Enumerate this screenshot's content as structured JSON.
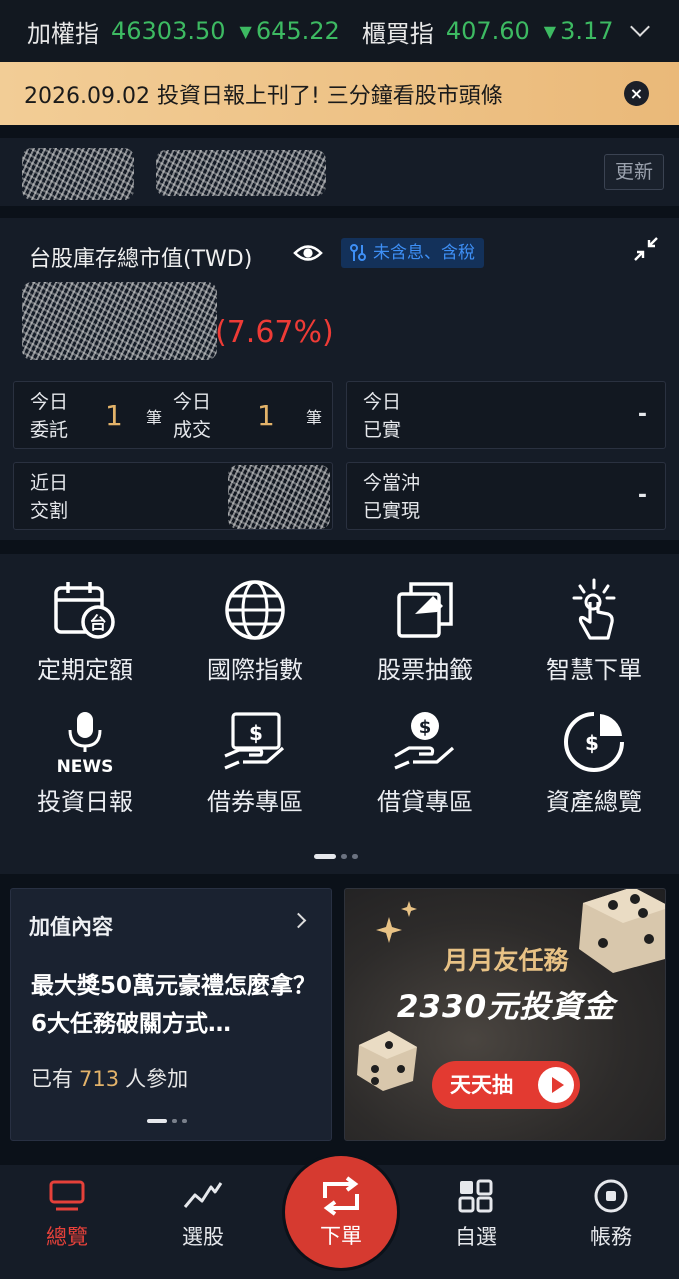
{
  "ticker": {
    "taiex_name": "加權指",
    "taiex_value": "46303.50",
    "taiex_change": "645.22",
    "otc_name": "櫃買指",
    "otc_value": "407.60",
    "otc_change": "3.17",
    "down_color": "#3dba62"
  },
  "notice": {
    "text": "2026.09.02 投資日報上刊了! 三分鐘看股市頭條",
    "close_label": "×"
  },
  "account": {
    "refresh_label": "更新"
  },
  "portfolio": {
    "title": "台股庫存總市值(TWD)",
    "tax_badge": "未含息、含稅",
    "percent": "(7.67%)",
    "boxes": {
      "today_orders": {
        "label1": "今日",
        "label2": "委託",
        "value": "1",
        "unit": "筆"
      },
      "today_fills": {
        "label1": "今日",
        "label2": "成交",
        "value": "1",
        "unit": "筆"
      },
      "today_realized": {
        "label1": "今日",
        "label2": "已實",
        "value": "-"
      },
      "recent_settle": {
        "label1": "近日",
        "label2": "交割"
      },
      "daytrade_realized": {
        "label1": "今當沖",
        "label2": "已實現",
        "value": "-"
      }
    }
  },
  "shortcuts": {
    "items": [
      {
        "label": "定期定額",
        "icon": "calendar-tw-icon"
      },
      {
        "label": "國際指數",
        "icon": "globe-icon"
      },
      {
        "label": "股票抽籤",
        "icon": "lottery-card-icon"
      },
      {
        "label": "智慧下單",
        "icon": "smart-tap-icon"
      },
      {
        "label": "投資日報",
        "icon": "news-mic-icon",
        "icon_text": "NEWS"
      },
      {
        "label": "借券專區",
        "icon": "stock-lending-icon",
        "icon_text": "$"
      },
      {
        "label": "借貸專區",
        "icon": "loan-hand-icon",
        "icon_text": "$"
      },
      {
        "label": "資產總覽",
        "icon": "asset-overview-icon",
        "icon_text": "$"
      }
    ]
  },
  "value_card": {
    "heading": "加值內容",
    "body": "最大獎50萬元豪禮怎麼拿？6大任務破關方式…",
    "join_prefix": "已有",
    "join_count": "713",
    "join_suffix": "人參加"
  },
  "promo_card": {
    "line1": "月月友任務",
    "line2": "2330元投資金",
    "button": "天天抽"
  },
  "nav": {
    "overview": "總覽",
    "stock_pick": "選股",
    "order": "下單",
    "watchlist": "自選",
    "account": "帳務",
    "active_color": "#e5413a"
  }
}
